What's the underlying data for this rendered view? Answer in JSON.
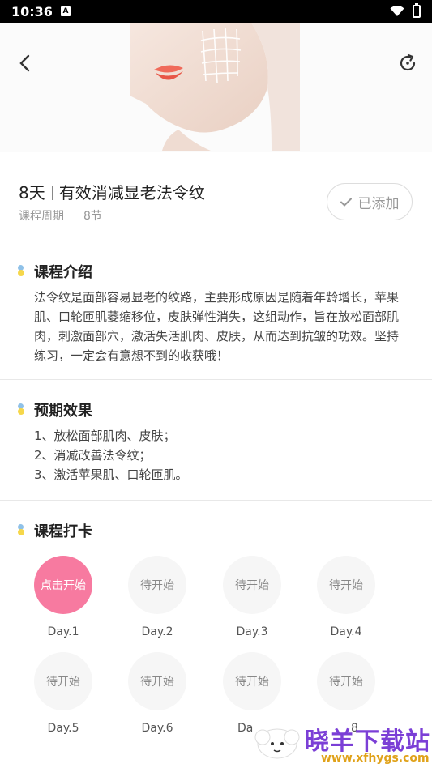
{
  "status_bar": {
    "time": "10:36",
    "a_badge": "A"
  },
  "hero": {
    "image": "face-with-grid-illustration"
  },
  "course": {
    "days": "8天",
    "name": "有效消减显老法令纹",
    "period_label": "课程周期",
    "sessions": "8节",
    "added_label": "已添加"
  },
  "intro": {
    "title": "课程介绍",
    "text": "法令纹是面部容易显老的纹路，主要形成原因是随着年龄增长，苹果肌、口轮匝肌萎缩移位，皮肤弹性消失，这组动作，旨在放松面部肌肉，刺激面部穴，激活失活肌肉、皮肤，从而达到抗皱的功效。坚持练习，一定会有意想不到的收获哦！"
  },
  "effects": {
    "title": "预期效果",
    "items": [
      "1、放松面部肌肉、皮肤；",
      "2、消减改善法令纹；",
      "3、激活苹果肌、口轮匝肌。"
    ]
  },
  "checkin": {
    "title": "课程打卡",
    "days": [
      {
        "status": "点击开始",
        "label": "Day.1",
        "active": true
      },
      {
        "status": "待开始",
        "label": "Day.2",
        "active": false
      },
      {
        "status": "待开始",
        "label": "Day.3",
        "active": false
      },
      {
        "status": "待开始",
        "label": "Day.4",
        "active": false
      },
      {
        "status": "待开始",
        "label": "Day.5",
        "active": false
      },
      {
        "status": "待开始",
        "label": "Day.6",
        "active": false
      },
      {
        "status": "待开始",
        "label": "Da",
        "active": false
      },
      {
        "status": "待开始",
        "label": "8",
        "active": false
      }
    ]
  },
  "watermark": {
    "text": "晓羊下载站",
    "url": "www.xfhygs.com"
  },
  "colors": {
    "accent_pink": "#f77aa0",
    "muted": "#999999",
    "watermark_purple": "#7b3fd6",
    "watermark_orange": "#e0a21a"
  }
}
